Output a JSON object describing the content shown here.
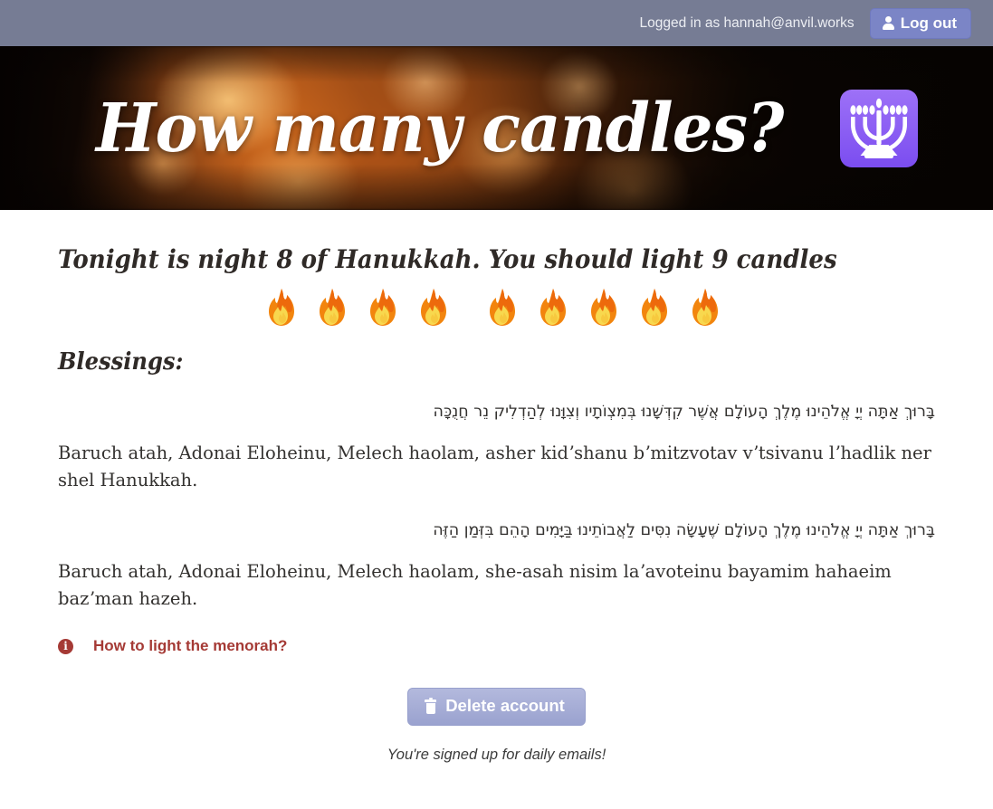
{
  "topbar": {
    "logged_in_text": "Logged in as hannah@anvil.works",
    "logout_label": "Log out",
    "user_icon": "user-icon",
    "background_color": "#767c94",
    "button_color": "#7b85c6"
  },
  "hero": {
    "title": "How many candles?",
    "emoji_icon": "menorah-icon",
    "emoji_color": "#8b5cf6"
  },
  "main": {
    "night_line": "Tonight is night 8 of Hanukkah. You should light 9 candles",
    "night_number": 8,
    "candle_count": 9,
    "flame_icon": "fire-icon",
    "blessings_heading": "Blessings:",
    "blessings": [
      {
        "hebrew": "בָּרוּךְ אַתָּה יְיָ אֱלֹהֵינוּ מֶלֶךְ הָעוֹלָם אֲשֶׁר קִדְּשָׁנוּ בְּמִצְוֹתָיו וְצִוָּנוּ לְהַדְלִיק נֵר חֲנֻכָּה",
        "transliteration": "Baruch atah, Adonai Eloheinu, Melech haolam, asher kidʼshanu bʼmitzvotav vʼtsivanu lʼhadlik ner shel Hanukkah."
      },
      {
        "hebrew": "בָּרוּךְ אַתָּה יְיָ אֱלֹהֵינוּ מֶלֶךְ הָעוֹלָם שֶׁעָשָׂה נִסִּים לַאֲבוֹתֵינוּ בַּיָּמִים הָהֵם בִּזְּמַן הַזֶּה",
        "transliteration": "Baruch atah, Adonai Eloheinu, Melech haolam, she-asah nisim laʼavoteinu bayamim hahaeim bazʼman hazeh."
      }
    ],
    "info_link_label": "How to light the menorah?",
    "info_icon": "info-circle-icon",
    "info_color": "#a53a35",
    "delete_label": "Delete account",
    "delete_icon": "trash-icon",
    "footer_note": "You're signed up for daily emails!"
  }
}
